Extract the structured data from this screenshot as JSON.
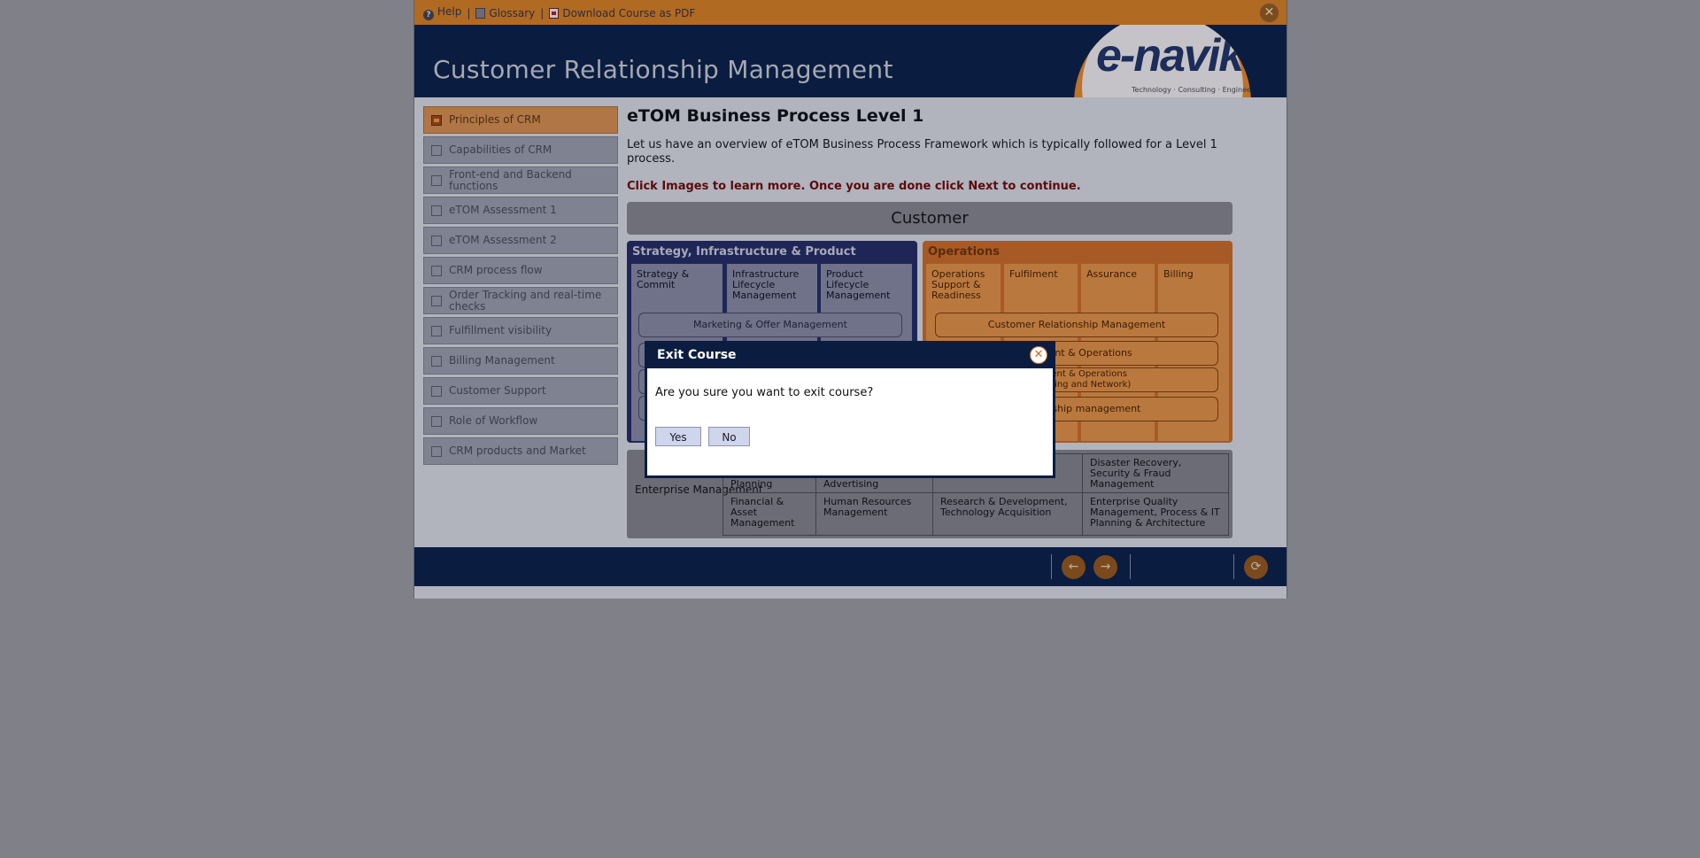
{
  "topbar": {
    "help": "Help",
    "glossary": "Glossary",
    "download": "Download Course as PDF",
    "separator": "|"
  },
  "header": {
    "title": "Customer Relationship Management",
    "logo_text": "e-navik",
    "logo_tagline": "Technology · Consulting · Engineering"
  },
  "sidebar": {
    "items": [
      {
        "label": "Principles of CRM",
        "active": true
      },
      {
        "label": "Capabilities of CRM"
      },
      {
        "label": "Front-end and Backend functions"
      },
      {
        "label": "eTOM Assessment 1"
      },
      {
        "label": "eTOM Assessment 2"
      },
      {
        "label": "CRM process flow"
      },
      {
        "label": "Order Tracking and real-time checks"
      },
      {
        "label": "Fulfillment visibility"
      },
      {
        "label": "Billing Management"
      },
      {
        "label": "Customer Support"
      },
      {
        "label": "Role of Workflow"
      },
      {
        "label": "CRM products and Market"
      }
    ]
  },
  "content": {
    "title": "eTOM Business Process Level 1",
    "intro": "Let us have an overview of eTOM Business Process Framework which is typically followed for a Level 1 process.",
    "instruction": "Click Images to learn more. Once you are done click Next to continue."
  },
  "diagram": {
    "customer": "Customer",
    "strategy": {
      "title": "Strategy, Infrastructure & Product",
      "columns": [
        "Strategy & Commit",
        "Infrastructure Lifecycle Management",
        "Product Lifecycle Management"
      ],
      "rows": [
        "Marketing & Offer Management"
      ]
    },
    "operations": {
      "title": "Operations",
      "columns": [
        "Operations Support & Readiness",
        "Fulfilment",
        "Assurance",
        "Billing"
      ],
      "rows": [
        "Customer Relationship Management",
        "agement & Operations",
        "agement & Operations\n(omputing and Network)",
        "Relationship management"
      ]
    },
    "enterprise": {
      "label": "Enterprise Management",
      "cells": [
        "Planning",
        "Advertising",
        "Disaster Recovery, Security & Fraud Management",
        "Financial & Asset Management",
        "Human Resources Management",
        "Research & Development, Technology Acquisition",
        "Enterprise Quality Management, Process & IT Planning & Architecture"
      ]
    }
  },
  "modal": {
    "title": "Exit Course",
    "message": "Are you sure you want to exit course?",
    "yes": "Yes",
    "no": "No"
  },
  "icons": {
    "help": "help-icon",
    "glossary": "glossary-icon",
    "pdf": "pdf-icon",
    "close": "close-icon",
    "back": "arrow-left-icon",
    "next": "arrow-right-icon",
    "refresh": "refresh-icon"
  },
  "colors": {
    "topbar": "#b06a22",
    "header": "#0a1d40",
    "modal_frame": "#0a1d40",
    "accent_orange": "#c9681c"
  }
}
